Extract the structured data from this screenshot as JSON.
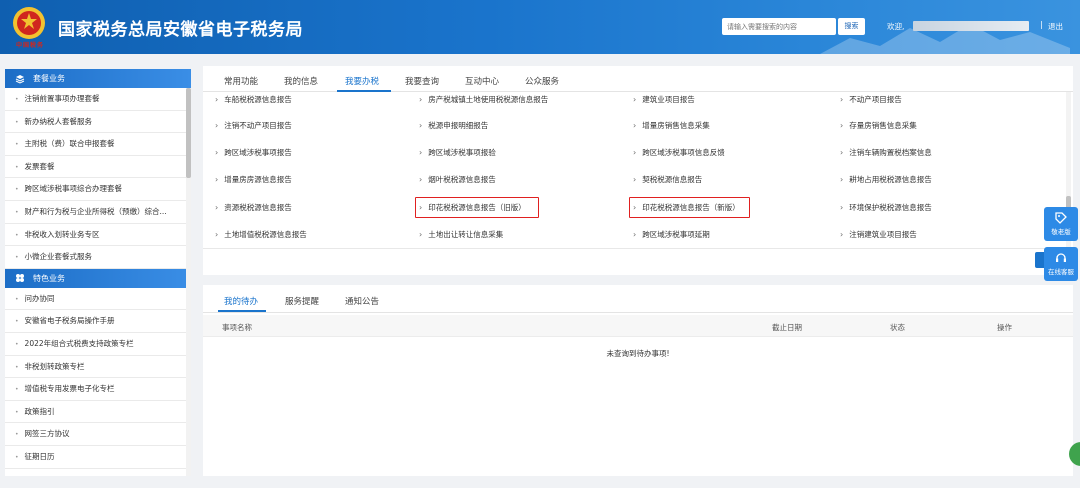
{
  "header": {
    "title": "国家税务总局安徽省电子税务局",
    "emblem_text": "中国税务",
    "search_placeholder": "请输入需要搜索的内容",
    "search_button": "搜索",
    "welcome": "欢迎,",
    "separator": "|",
    "logout": "退出"
  },
  "sidebar": {
    "section1_title": "套餐业务",
    "section1_items": [
      "注销前置事项办理套餐",
      "新办纳税人套餐服务",
      "主附税（费）联合申报套餐",
      "发票套餐",
      "跨区域涉税事项综合办理套餐",
      "财产和行为税与企业所得税（预缴）综合...",
      "非税收入划转业务专区",
      "小微企业套餐式服务"
    ],
    "section2_title": "特色业务",
    "section2_items": [
      "问办协同",
      "安徽省电子税务局操作手册",
      "2022年组合式税费支持政策专栏",
      "非税划转政策专栏",
      "增值税专用发票电子化专栏",
      "政策指引",
      "网签三方协议",
      "征期日历"
    ]
  },
  "top_panel": {
    "tabs": [
      "常用功能",
      "我的信息",
      "我要办税",
      "我要查询",
      "互动中心",
      "公众服务"
    ],
    "active_tab": "我要办税",
    "rows": [
      [
        "车船税税源信息报告",
        "房产税城镇土地使用税税源信息报告",
        "建筑业项目报告",
        "不动产项目报告"
      ],
      [
        "注销不动产项目报告",
        "税源申报明细报告",
        "增量房销售信息采集",
        "存量房销售信息采集"
      ],
      [
        "跨区域涉税事项报告",
        "跨区域涉税事项报验",
        "跨区域涉税事项信息反馈",
        "注销车辆购置税档案信息"
      ],
      [
        "增量房房源信息报告",
        "烟叶税税源信息报告",
        "契税税源信息报告",
        "耕地占用税税源信息报告"
      ],
      [
        "资源税税源信息报告",
        "印花税税源信息报告（旧版）",
        "印花税税源信息报告（新版）",
        "环境保护税税源信息报告"
      ],
      [
        "土地增值税税源信息报告",
        "土地出让转让信息采集",
        "跨区域涉税事项延期",
        "注销建筑业项目报告"
      ]
    ]
  },
  "bottom_panel": {
    "tabs": [
      "我的待办",
      "服务提醒",
      "通知公告"
    ],
    "active_tab": "我的待办",
    "columns": [
      "事项名称",
      "截止日期",
      "状态",
      "操作"
    ],
    "empty_message": "未查询到待办事项!"
  },
  "float": {
    "btn1": "敬老版",
    "btn2": "在线客服"
  },
  "colors": {
    "primary": "#1a74cc",
    "highlight_border": "#e02020"
  }
}
